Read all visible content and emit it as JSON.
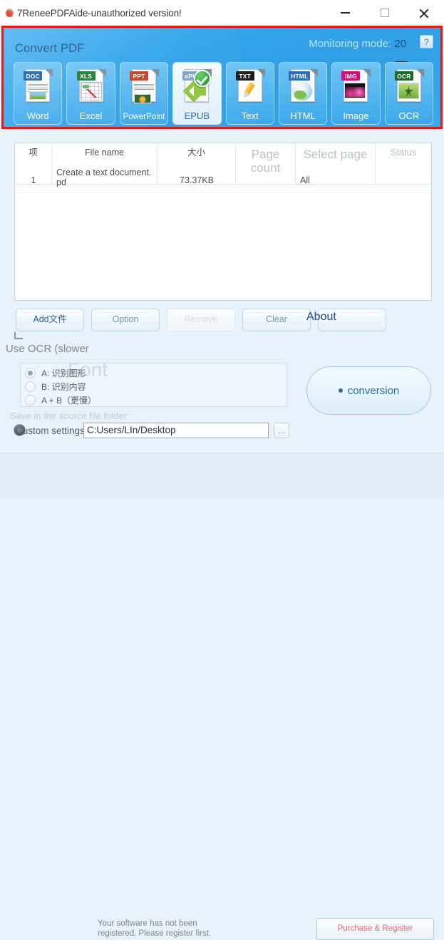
{
  "window": {
    "title": "7ReneePDFAide-unauthorized version!",
    "icon": "flame-icon",
    "minimize_label": "—",
    "maximize_label": "□",
    "close_label": "✕"
  },
  "toolbar": {
    "title": "Convert PDF",
    "monitoring_mode_label": "Monitoring mode:",
    "monitoring_mode_value": "20",
    "help_label": "?",
    "highlight_color": "#e01b17",
    "formats": [
      {
        "label": "Word",
        "tag": "DOC",
        "tag_color": "#1f5fa8",
        "selected": false
      },
      {
        "label": "Excel",
        "tag": "XLS",
        "tag_color": "#1d7a33",
        "selected": false
      },
      {
        "label": "PowerPoint",
        "tag": "PPT",
        "tag_color": "#c8402a",
        "selected": false
      },
      {
        "label": "EPUB",
        "tag": "ePUB",
        "tag_color": "#7fa7c4",
        "selected": true
      },
      {
        "label": "Text",
        "tag": "TXT",
        "tag_color": "#1c1c1c",
        "selected": false
      },
      {
        "label": "HTML",
        "tag": "HTML",
        "tag_color": "#2b6fb5",
        "selected": false
      },
      {
        "label": "Image",
        "tag": "IMG",
        "tag_color": "#d1107e",
        "selected": false
      },
      {
        "label": "OCR",
        "tag": "OCR",
        "tag_color": "#1d6b2a",
        "selected": false
      }
    ]
  },
  "file_table": {
    "columns": [
      {
        "key": "index",
        "label": "项"
      },
      {
        "key": "filename",
        "label": "File name"
      },
      {
        "key": "size",
        "label": "大小"
      },
      {
        "key": "page_count",
        "label": "Page count"
      },
      {
        "key": "select_page",
        "label": "Select page"
      },
      {
        "key": "status",
        "label": "Status"
      }
    ],
    "rows": [
      {
        "index": "1",
        "filename": "Create a text document. pd",
        "size": "73.37KB",
        "page_count": "",
        "select_page": "All",
        "status": ""
      }
    ]
  },
  "actions": {
    "add_file": "Add文件",
    "option": "Option",
    "remove": "Remove",
    "clear": "Clear",
    "about": "About"
  },
  "ocr": {
    "use_ocr_label": "Use OCR (slower",
    "group_title": "Font",
    "options": [
      {
        "label": "A: 识别图形",
        "selected": true
      },
      {
        "label": "B: 识别内容",
        "selected": false
      },
      {
        "label": "A + B（更慢）",
        "selected": false
      }
    ]
  },
  "convert": {
    "label": "conversion"
  },
  "output": {
    "source_folder_label": "Save in the source file folder",
    "custom_settings_label": "Custom settings",
    "path_value": "C:Users/LIn/Desktop",
    "browse_label": "..."
  },
  "status_bar": {
    "message": "Your software has not been registered. Please register first.",
    "register_button": "Purchase & Register"
  }
}
